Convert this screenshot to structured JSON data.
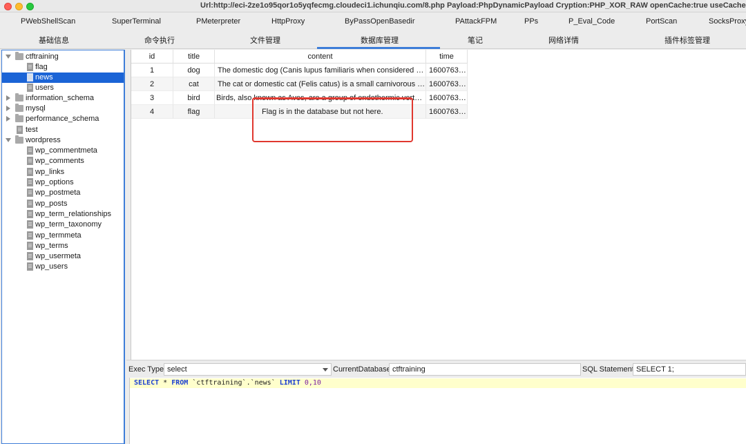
{
  "window": {
    "title": "Url:http://eci-2ze1o95qor1o5yqfecmg.cloudeci1.ichunqiu.com/8.php Payload:PhpDynamicPayload Cryption:PHP_XOR_RAW openCache:true useCache:f"
  },
  "plugin_tabs": [
    {
      "label": "PWebShellScan"
    },
    {
      "label": "SuperTerminal"
    },
    {
      "label": "PMeterpreter"
    },
    {
      "label": "HttpProxy"
    },
    {
      "label": "ByPassOpenBasedir"
    },
    {
      "label": "PAttackFPM"
    },
    {
      "label": "PPs"
    },
    {
      "label": "P_Eval_Code"
    },
    {
      "label": "PortScan"
    },
    {
      "label": "SocksProxy"
    }
  ],
  "main_tabs": [
    {
      "label": "基础信息"
    },
    {
      "label": "命令执行"
    },
    {
      "label": "文件管理"
    },
    {
      "label": "数据库管理",
      "selected": true
    },
    {
      "label": "笔记"
    },
    {
      "label": "网络详情"
    },
    {
      "label": "插件标签管理"
    }
  ],
  "tree": [
    {
      "label": "ctftraining",
      "type": "folder",
      "expanded": true,
      "level": 0
    },
    {
      "label": "flag",
      "type": "table",
      "level": 1
    },
    {
      "label": "news",
      "type": "table",
      "level": 1,
      "selected": true
    },
    {
      "label": "users",
      "type": "table",
      "level": 1
    },
    {
      "label": "information_schema",
      "type": "folder",
      "expanded": false,
      "level": 0
    },
    {
      "label": "mysql",
      "type": "folder",
      "expanded": false,
      "level": 0
    },
    {
      "label": "performance_schema",
      "type": "folder",
      "expanded": false,
      "level": 0
    },
    {
      "label": "test",
      "type": "table",
      "level": 0
    },
    {
      "label": "wordpress",
      "type": "folder",
      "expanded": true,
      "level": 0
    },
    {
      "label": "wp_commentmeta",
      "type": "table",
      "level": 1
    },
    {
      "label": "wp_comments",
      "type": "table",
      "level": 1
    },
    {
      "label": "wp_links",
      "type": "table",
      "level": 1
    },
    {
      "label": "wp_options",
      "type": "table",
      "level": 1
    },
    {
      "label": "wp_postmeta",
      "type": "table",
      "level": 1
    },
    {
      "label": "wp_posts",
      "type": "table",
      "level": 1
    },
    {
      "label": "wp_term_relationships",
      "type": "table",
      "level": 1
    },
    {
      "label": "wp_term_taxonomy",
      "type": "table",
      "level": 1
    },
    {
      "label": "wp_termmeta",
      "type": "table",
      "level": 1
    },
    {
      "label": "wp_terms",
      "type": "table",
      "level": 1
    },
    {
      "label": "wp_usermeta",
      "type": "table",
      "level": 1
    },
    {
      "label": "wp_users",
      "type": "table",
      "level": 1
    }
  ],
  "grid": {
    "columns": [
      "id",
      "title",
      "content",
      "time"
    ],
    "rows": [
      [
        "1",
        "dog",
        "The domestic dog (Canis lupus familiaris when considered a ...",
        "16007631..."
      ],
      [
        "2",
        "cat",
        "The cat or domestic cat (Felis catus) is a small carnivorous m...",
        "16007631..."
      ],
      [
        "3",
        "bird",
        "Birds, also known as Aves, are a group of endothermic verteb...",
        "16007631..."
      ],
      [
        "4",
        "flag",
        "Flag is in the database but not here.",
        "16007631..."
      ]
    ]
  },
  "query_bar": {
    "exec_type_label": "Exec Type",
    "exec_type_value": "select",
    "current_db_label": "CurrentDatabase",
    "current_db_value": "ctftraining",
    "sql_statement_label": "SQL Statement",
    "sql_statement_value": "SELECT 1;"
  },
  "editor": {
    "tokens": [
      {
        "t": "SELECT",
        "c": "kw"
      },
      {
        "t": " * ",
        "c": "str"
      },
      {
        "t": "FROM",
        "c": "kw"
      },
      {
        "t": " `ctftraining`.`news` ",
        "c": "str"
      },
      {
        "t": "LIMIT",
        "c": "kw"
      },
      {
        "t": " ",
        "c": "str"
      },
      {
        "t": "0,10",
        "c": "num"
      }
    ]
  },
  "colors": {
    "accent": "#3d7dd8",
    "selection": "#1b64d6",
    "annotation": "#e0372e",
    "sql_keyword": "#1b3fd0"
  }
}
